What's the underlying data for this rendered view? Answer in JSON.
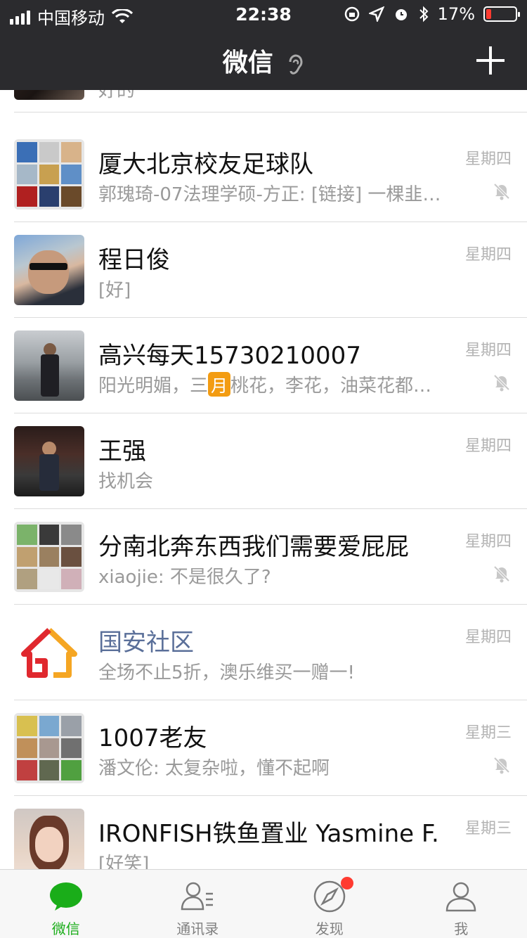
{
  "status_bar": {
    "carrier": "中国移动",
    "time": "22:38",
    "battery": "17%"
  },
  "nav": {
    "title": "微信"
  },
  "partial_row": {
    "preview": "好的"
  },
  "chats": [
    {
      "name": "厦大北京校友足球队",
      "preview": "郭瑰琦-07法理学硕-方正: [链接] 一棵韭…",
      "date": "星期四",
      "muted": true
    },
    {
      "name": "程日俊",
      "preview": "[好]",
      "date": "星期四",
      "muted": false
    },
    {
      "name": "高兴每天15730210007",
      "preview_before": "阳光明媚，三",
      "preview_emoji": "月",
      "preview_after": "桃花，李花，油菜花都…",
      "date": "星期四",
      "muted": true
    },
    {
      "name": "王强",
      "preview": "找机会",
      "date": "星期四",
      "muted": false
    },
    {
      "name": "分南北奔东西我们需要爱屁屁",
      "preview": "xiaojie: 不是很久了?",
      "date": "星期四",
      "muted": true
    },
    {
      "name": "国安社区",
      "preview": "全场不止5折，澳乐维买一赠一!",
      "date": "星期四",
      "muted": false
    },
    {
      "name": "1007老友",
      "preview": "潘文伦: 太复杂啦，懂不起啊",
      "date": "星期三",
      "muted": true
    },
    {
      "name": "IRONFISH铁鱼置业 Yasmine F.",
      "preview": "[好笑]",
      "date": "星期三",
      "muted": false
    }
  ],
  "tabs": [
    {
      "label": "微信",
      "icon": "chat-bubble-icon",
      "active": true
    },
    {
      "label": "通讯录",
      "icon": "contacts-icon",
      "active": false
    },
    {
      "label": "发现",
      "icon": "compass-icon",
      "active": false,
      "badge": true
    },
    {
      "label": "我",
      "icon": "person-icon",
      "active": false
    }
  ],
  "colors": {
    "nav_bg": "#2b2b2e",
    "active_green": "#1aad19",
    "official_link": "#5a6f99",
    "badge_red": "#ff3b30"
  }
}
